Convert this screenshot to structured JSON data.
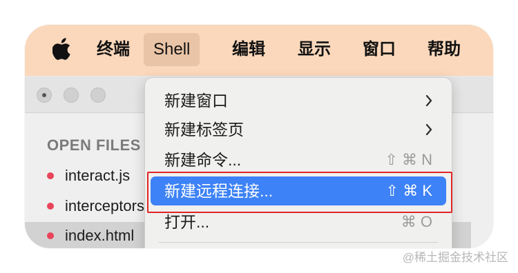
{
  "menubar": {
    "apple_icon": "apple-logo-icon",
    "items": [
      {
        "label": "终端"
      },
      {
        "label": "Shell"
      },
      {
        "label": "编辑"
      },
      {
        "label": "显示"
      },
      {
        "label": "窗口"
      },
      {
        "label": "帮助"
      }
    ]
  },
  "sidebar": {
    "section_title": "OPEN FILES",
    "files": [
      {
        "name": "interact.js"
      },
      {
        "name": "interceptors.js"
      },
      {
        "name": "index.html"
      }
    ]
  },
  "shell_menu": {
    "items": [
      {
        "label": "新建窗口",
        "submenu": true
      },
      {
        "label": "新建标签页",
        "submenu": true
      },
      {
        "label": "新建命令...",
        "shortcut": "⇧ ⌘ N"
      },
      {
        "label": "新建远程连接...",
        "shortcut": "⇧ ⌘ K",
        "highlighted": true
      },
      {
        "label": "打开...",
        "shortcut": "⌘ O"
      }
    ]
  },
  "colors": {
    "menubar_bg": "#fbd8bb",
    "highlight": "#3d82f6",
    "callout_box": "#e02424",
    "file_dot": "#e8455b"
  },
  "watermark": "@稀土掘金技术社区"
}
